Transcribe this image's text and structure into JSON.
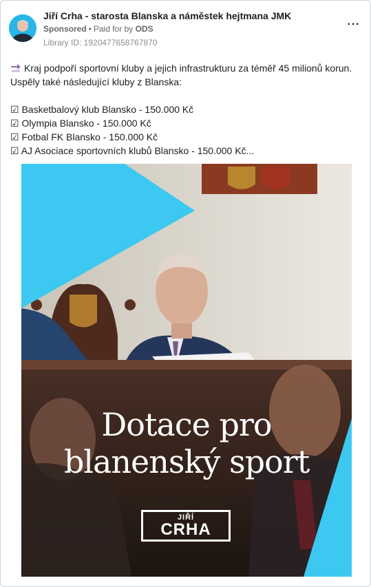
{
  "post": {
    "page_name": "Jiří Crha - starosta Blanska a náměstek hejtmana JMK",
    "sponsored_label": "Sponsored",
    "separator": "•",
    "paid_for_prefix": "Paid for by",
    "payer": "ODS",
    "library_id": "Library ID: 1920477658767870",
    "more_icon": "more-horizontal-icon"
  },
  "body": {
    "intro_emoji": "arrow-soon-icon",
    "intro_line1": "Kraj podpoří sportovní kluby a jejich infrastrukturu za téměř 45 milionů korun.",
    "intro_line2": "Uspěly také následující kluby z Blanska:",
    "check_mark": "☑",
    "items": [
      "Basketbalový klub Blansko - 150.000 Kč",
      "Olympia Blansko - 150.000 Kč",
      "Fotbal FK Blansko - 150.000 Kč",
      "AJ Asociace sportovních klubů Blansko - 150.000 Kč..."
    ]
  },
  "creative": {
    "headline_line1": "Dotace pro",
    "headline_line2": "blanenský sport",
    "logo_line1": "JIŘÍ",
    "logo_line2": "CRHA",
    "accent_color": "#3cc8f0"
  }
}
